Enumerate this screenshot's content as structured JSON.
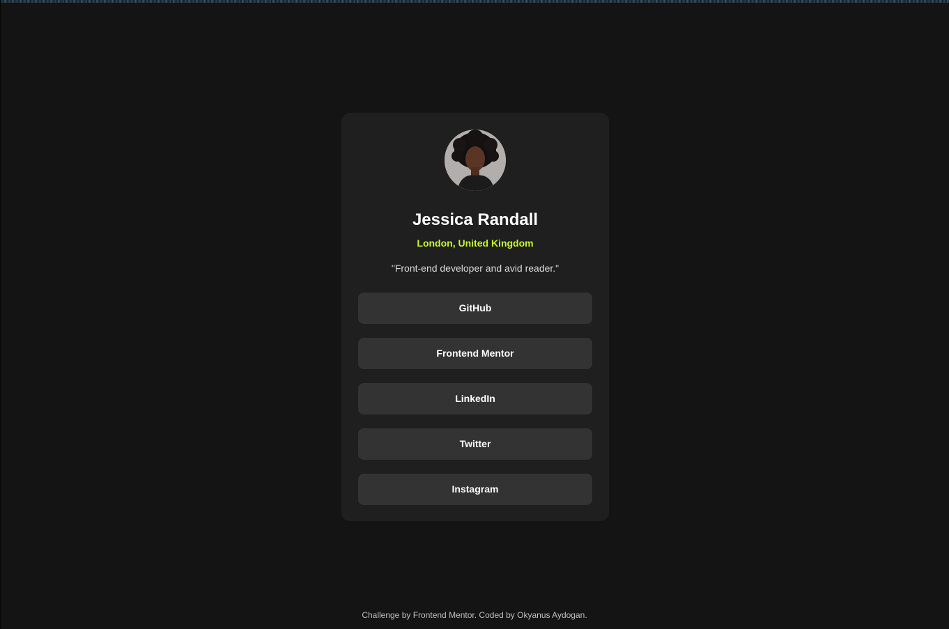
{
  "profile": {
    "name": "Jessica Randall",
    "location": "London, United Kingdom",
    "bio": "\"Front-end developer and avid reader.\"",
    "avatar_icon": "profile-photo"
  },
  "links": [
    {
      "label": "GitHub"
    },
    {
      "label": "Frontend Mentor"
    },
    {
      "label": "LinkedIn"
    },
    {
      "label": "Twitter"
    },
    {
      "label": "Instagram"
    }
  ],
  "footer": {
    "prefix": "Challenge by ",
    "challenge_link": "Frontend Mentor",
    "middle": ". Coded by ",
    "author_link": "Okyanus Aydogan",
    "suffix": "."
  },
  "colors": {
    "background": "#141414",
    "card": "#1f1f1f",
    "button": "#333333",
    "accent": "#c4f82a",
    "text": "#ffffff"
  }
}
